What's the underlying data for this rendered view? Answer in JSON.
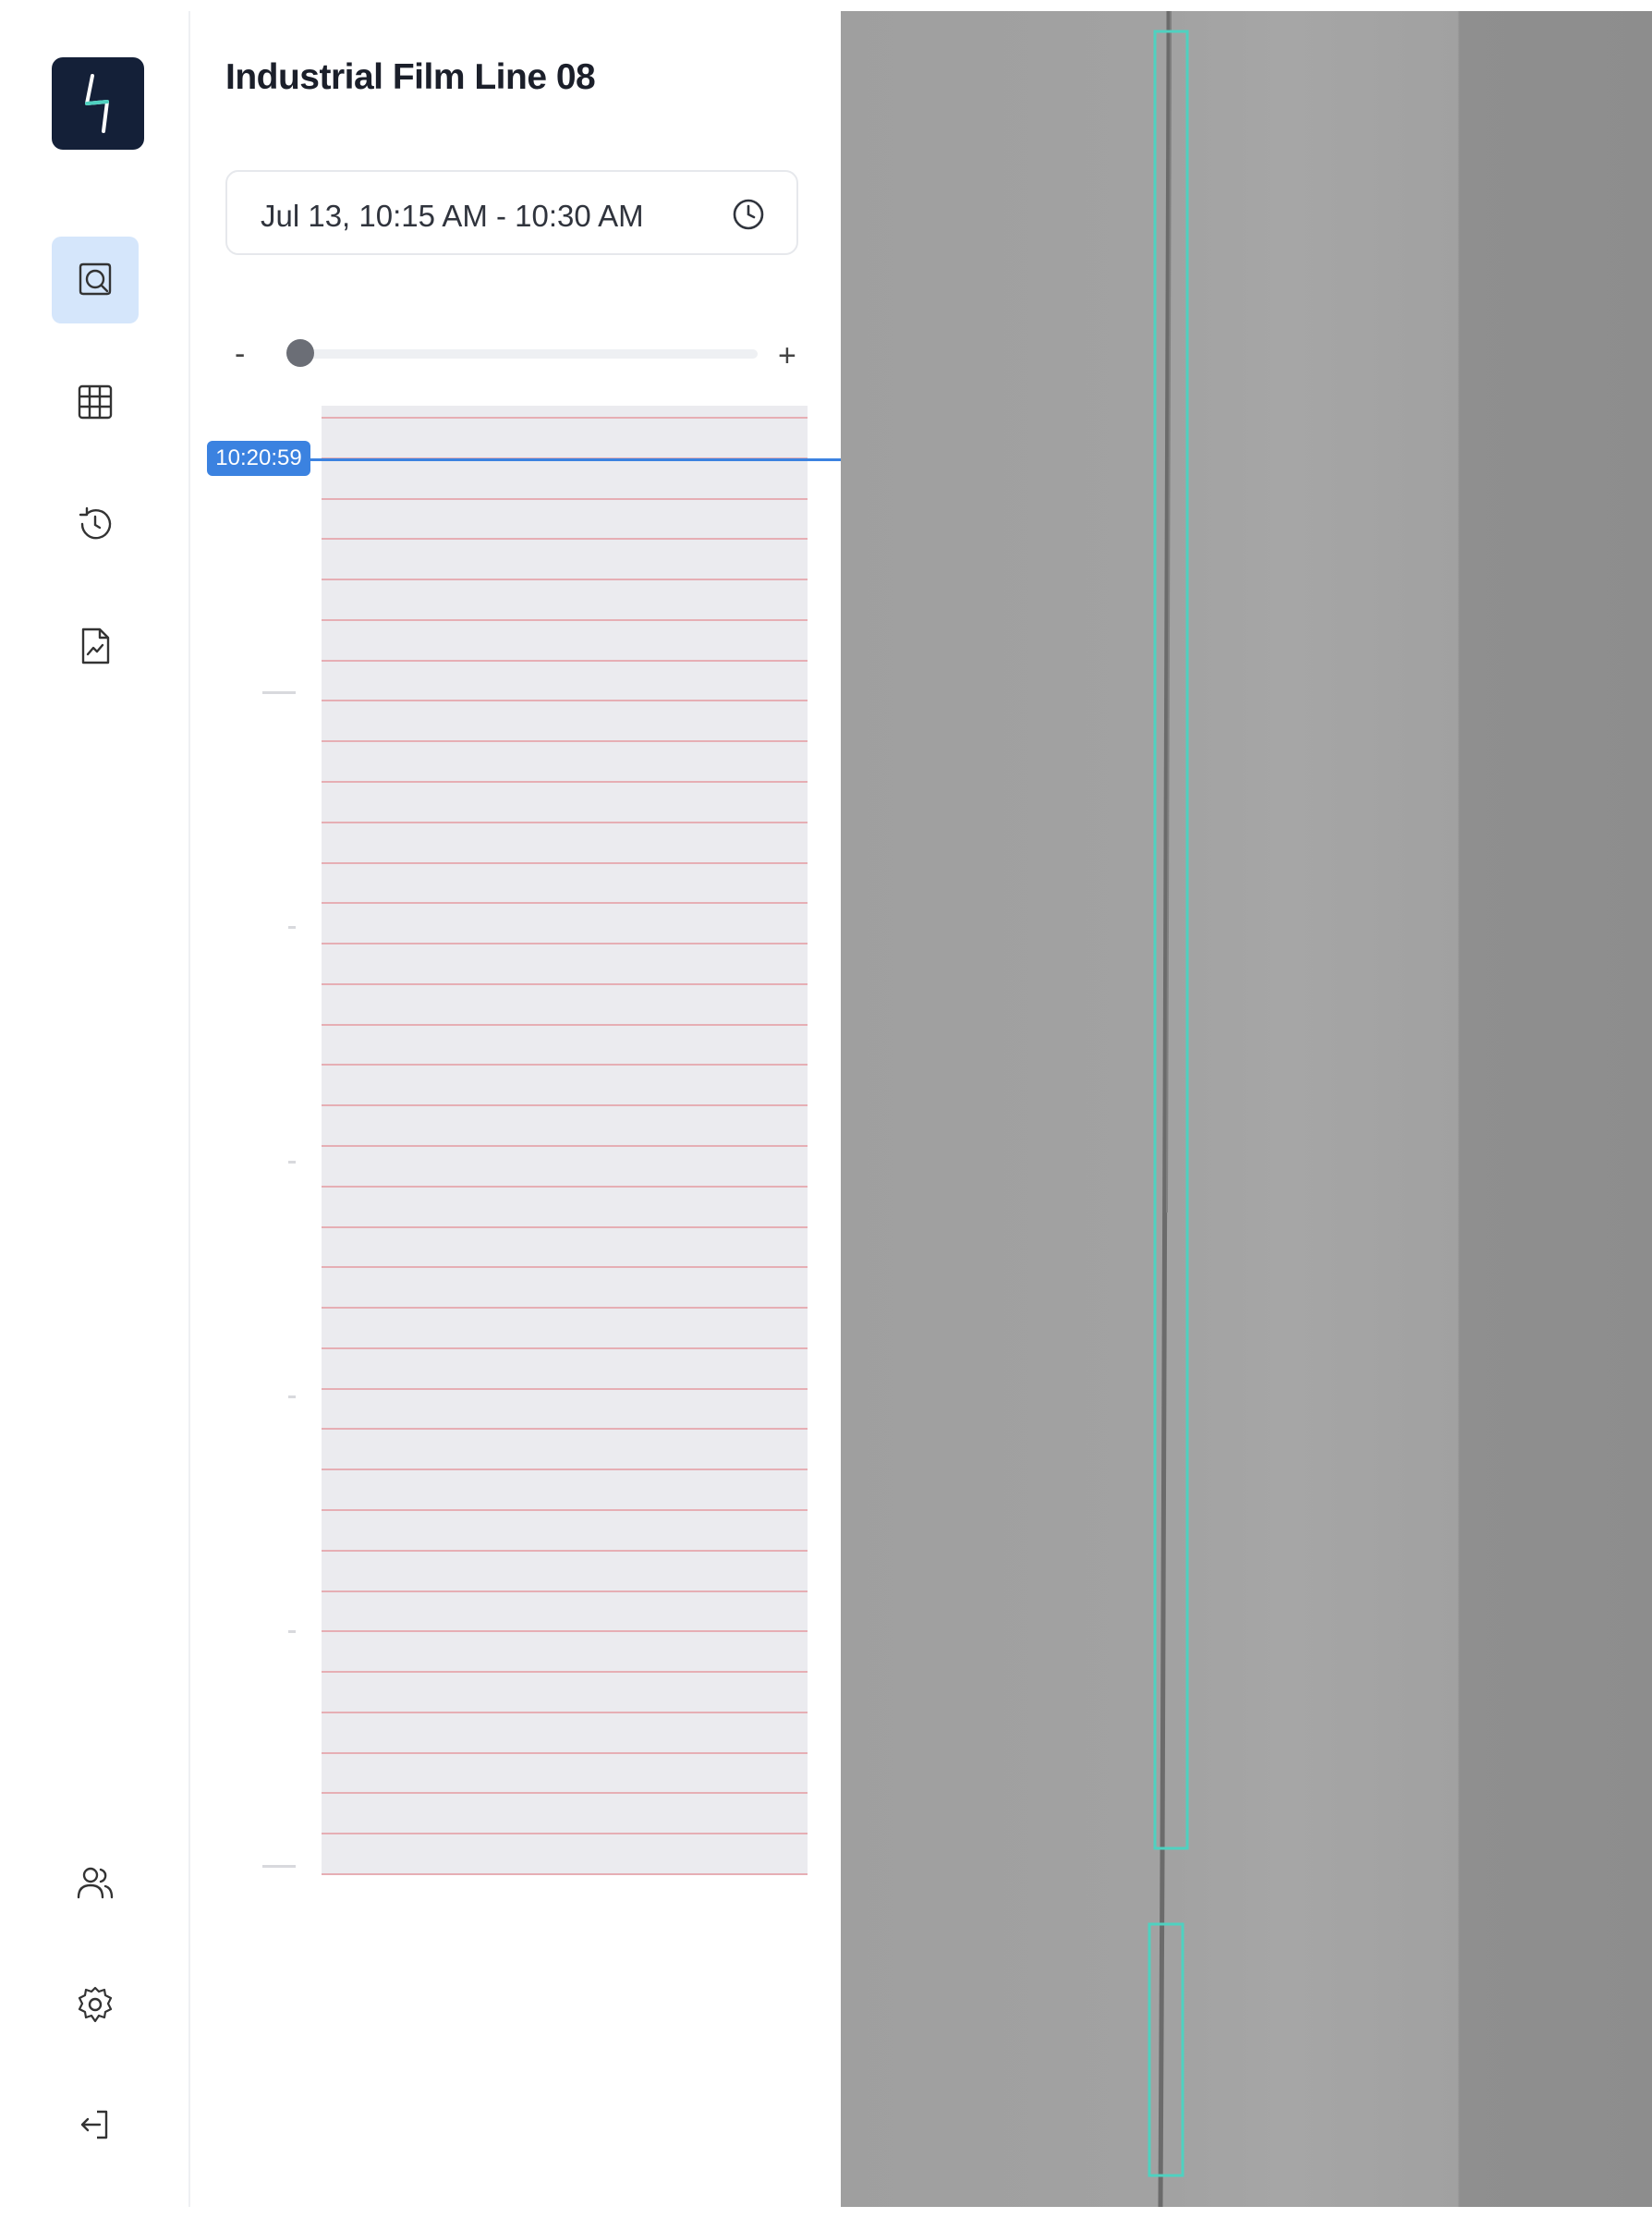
{
  "sidebar": {
    "logo_icon": "lightning-bolt-icon",
    "items": [
      {
        "name": "inspection",
        "icon": "search-frame-icon",
        "active": true
      },
      {
        "name": "grid",
        "icon": "grid-icon",
        "active": false
      },
      {
        "name": "history",
        "icon": "history-icon",
        "active": false
      },
      {
        "name": "reports",
        "icon": "report-chart-icon",
        "active": false
      }
    ],
    "bottom_items": [
      {
        "name": "users",
        "icon": "users-icon"
      },
      {
        "name": "settings",
        "icon": "gear-icon"
      },
      {
        "name": "logout",
        "icon": "logout-icon"
      }
    ]
  },
  "panel": {
    "title": "Industrial Film Line 08",
    "time_range": "Jul 13, 10:15 AM - 10:30 AM",
    "zoom": {
      "minus": "-",
      "plus": "+",
      "level": 0.03
    },
    "timeline": {
      "cursor_time": "10:20:59",
      "cursor_color": "#3b82e0",
      "defect_line_color": "#e6aeb4",
      "defect_marks": 37
    }
  },
  "colors": {
    "accent": "#3b82e0",
    "logo_bg": "#142038",
    "active_nav_bg": "#d5e6fb",
    "detection_box": "#4fd1c0"
  }
}
